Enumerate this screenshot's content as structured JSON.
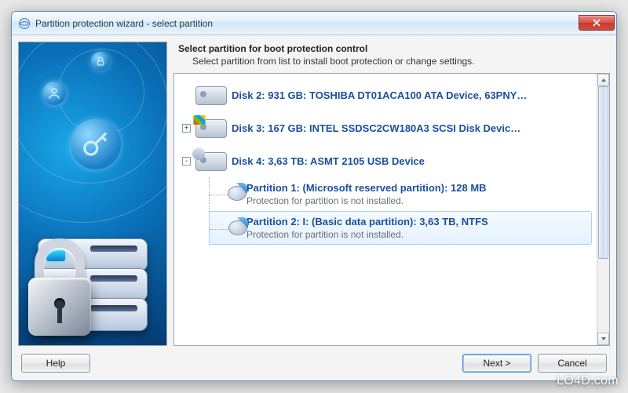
{
  "window": {
    "title": "Partition protection wizard - select partition"
  },
  "header": {
    "title": "Select partition for boot protection control",
    "subtitle": "Select partition from list to install boot protection or change settings."
  },
  "disks": [
    {
      "expander": "",
      "flag": "",
      "label": "Disk 2: 931 GB: TOSHIBA DT01ACA100 ATA Device, 63PNY…",
      "expanded": false,
      "partitions": []
    },
    {
      "expander": "+",
      "flag": "win",
      "label": "Disk 3: 167 GB: INTEL SSDSC2CW180A3 SCSI Disk Devic…",
      "expanded": false,
      "partitions": []
    },
    {
      "expander": "-",
      "flag": "usb",
      "label": "Disk 4: 3,63 TB: ASMT 2105 USB Device",
      "expanded": true,
      "partitions": [
        {
          "title": "Partition 1: (Microsoft reserved partition): 128 MB",
          "status": "Protection for partition is not installed.",
          "selected": false
        },
        {
          "title": "Partition 2: I: (Basic data partition): 3,63 TB, NTFS",
          "status": "Protection for partition is not installed.",
          "selected": true
        }
      ]
    }
  ],
  "buttons": {
    "help": "Help",
    "next": "Next  >",
    "cancel": "Cancel"
  },
  "watermark": "LO4D.com",
  "colors": {
    "link": "#1a4f9c",
    "close": "#c73a30"
  }
}
